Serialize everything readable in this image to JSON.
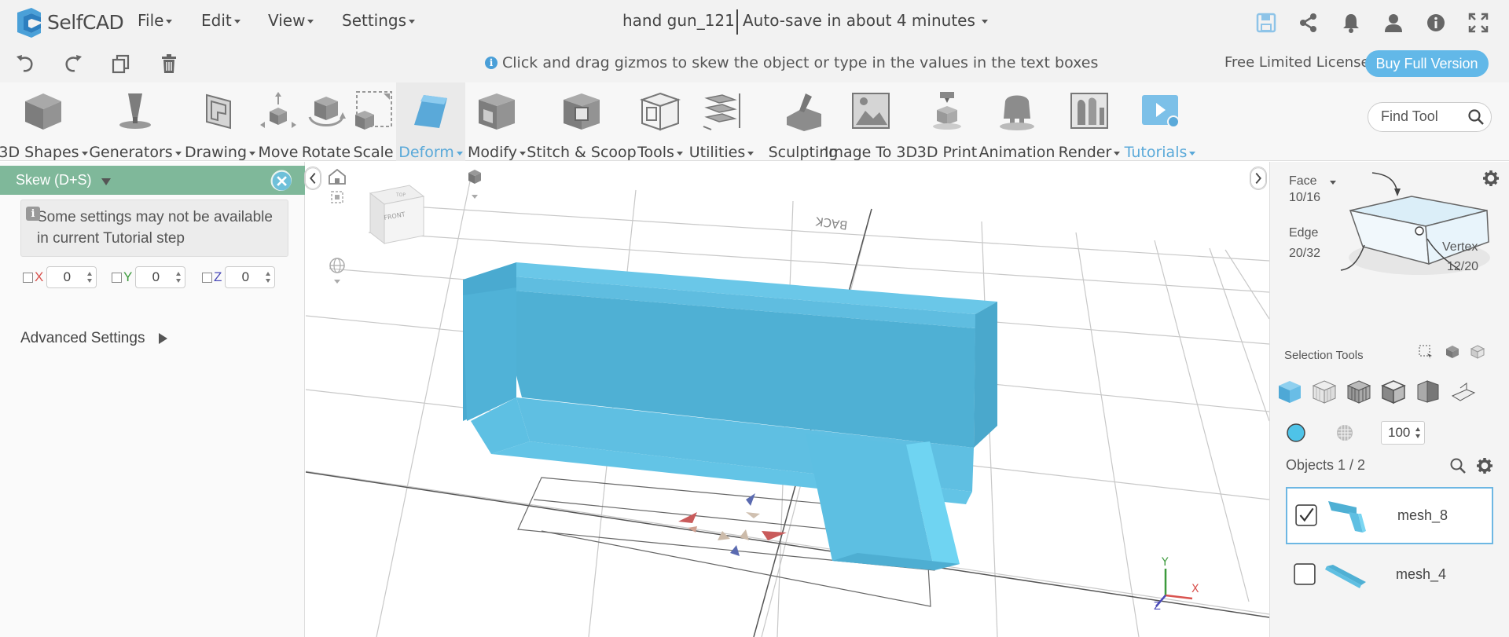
{
  "app": {
    "logo_text": "SelfCAD",
    "menus": [
      "File",
      "Edit",
      "View",
      "Settings"
    ],
    "document_title": "hand gun_121",
    "autosave": "Auto-save in about 4 minutes"
  },
  "subbar": {
    "hint": "Click and drag gizmos to skew the object or type in the values in the text boxes",
    "license": "Free Limited License",
    "buy_label": "Buy Full Version"
  },
  "ribbon": {
    "tools": [
      {
        "label": "3D Shapes",
        "dropdown": true
      },
      {
        "label": "Generators",
        "dropdown": true
      },
      {
        "label": "Drawing",
        "dropdown": true
      },
      {
        "label": "Move",
        "dropdown": false
      },
      {
        "label": "Rotate",
        "dropdown": false
      },
      {
        "label": "Scale",
        "dropdown": false
      },
      {
        "label": "Deform",
        "dropdown": true
      },
      {
        "label": "Modify",
        "dropdown": true
      },
      {
        "label": "Stitch & Scoop",
        "dropdown": false
      },
      {
        "label": "Tools",
        "dropdown": true
      },
      {
        "label": "Utilities",
        "dropdown": true
      },
      {
        "label": "Sculpting",
        "dropdown": false
      },
      {
        "label": "Image To 3D",
        "dropdown": false
      },
      {
        "label": "3D Print",
        "dropdown": false
      },
      {
        "label": "Animation",
        "dropdown": false
      },
      {
        "label": "Render",
        "dropdown": true
      },
      {
        "label": "Tutorials",
        "dropdown": true
      }
    ],
    "find_placeholder": "Find Tool"
  },
  "left_panel": {
    "title": "Skew (D+S)",
    "notice": "Some settings may not be available in current Tutorial step",
    "axes": [
      {
        "label": "X",
        "value": "0",
        "color": "#d9534f"
      },
      {
        "label": "Y",
        "value": "0",
        "color": "#3c9a3c"
      },
      {
        "label": "Z",
        "value": "0",
        "color": "#4a4ab8"
      }
    ],
    "advanced": "Advanced Settings"
  },
  "viewport": {
    "back_label": "BACK",
    "cube_front": "FRONT",
    "cube_top": "TOP",
    "axis_x": "X",
    "axis_y": "Y",
    "axis_z": "Z"
  },
  "right_panel": {
    "face_label": "Face",
    "face_count": "10/16",
    "edge_label": "Edge",
    "edge_count": "20/32",
    "vertex_label": "Vertex",
    "vertex_count": "12/20",
    "selection_tools": "Selection Tools",
    "opacity": "100",
    "objects_label": "Objects 1 / 2",
    "objects": [
      {
        "name": "mesh_8",
        "checked": true
      },
      {
        "name": "mesh_4",
        "checked": false
      }
    ]
  },
  "colors": {
    "accent": "#5aa9d9",
    "panel_header": "#7fb89a",
    "mesh": "#5bbcdf"
  }
}
